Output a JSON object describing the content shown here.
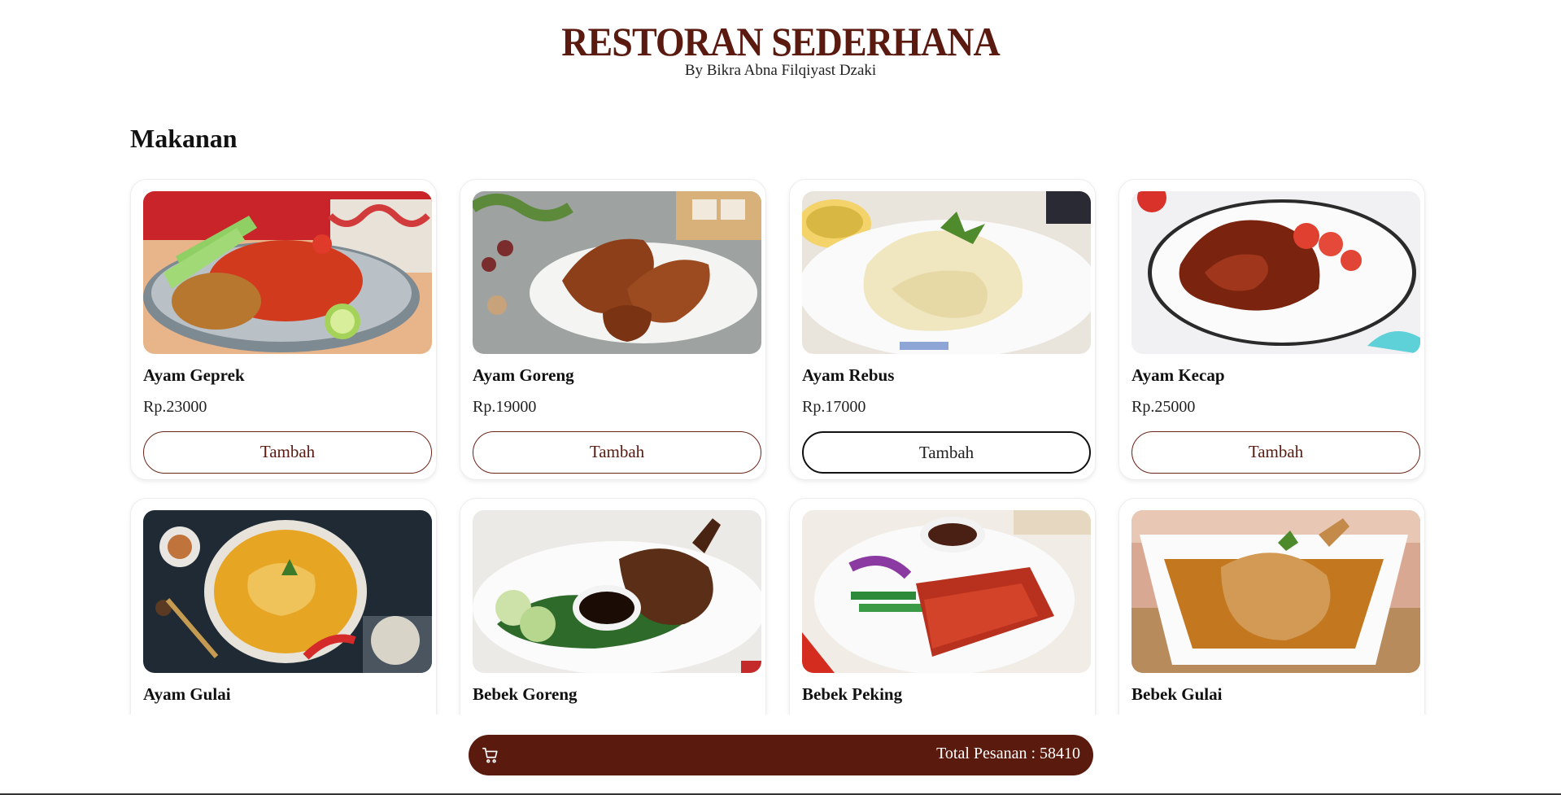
{
  "header": {
    "title": "RESTORAN SEDERHANA",
    "subtitle": "By Bikra Abna Filqiyast Dzaki"
  },
  "section": {
    "title": "Makanan"
  },
  "add_label": "Tambah",
  "menu": [
    {
      "name": "Ayam Geprek",
      "price": "Rp.23000"
    },
    {
      "name": "Ayam Goreng",
      "price": "Rp.19000"
    },
    {
      "name": "Ayam Rebus",
      "price": "Rp.17000"
    },
    {
      "name": "Ayam Kecap",
      "price": "Rp.25000"
    },
    {
      "name": "Ayam Gulai",
      "price": ""
    },
    {
      "name": "Bebek Goreng",
      "price": ""
    },
    {
      "name": "Bebek Peking",
      "price": ""
    },
    {
      "name": "Bebek Gulai",
      "price": ""
    }
  ],
  "cart": {
    "icon": "cart-icon",
    "total_label": "Total Pesanan : 58410"
  },
  "colors": {
    "brand": "#5a1a10",
    "cart_bar": "#5a1a0d"
  }
}
